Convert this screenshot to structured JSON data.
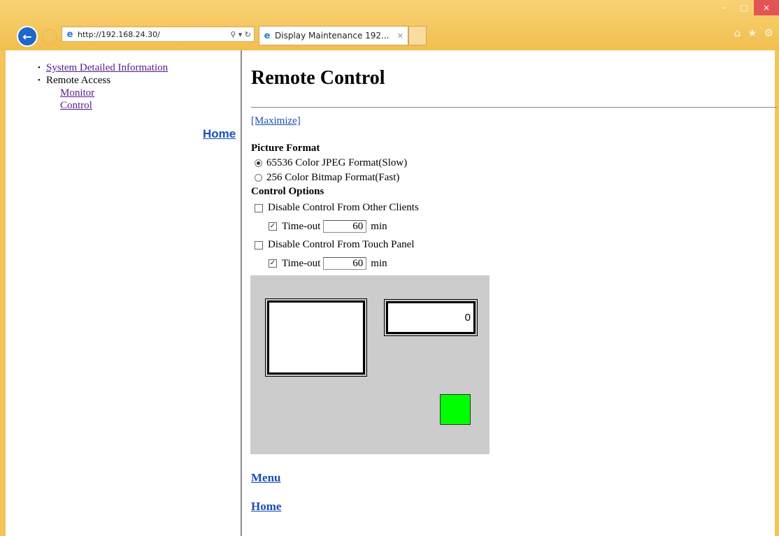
{
  "browser": {
    "url_host": "http://192.168.24.30/",
    "tab_title": "Display Maintenance 192...",
    "window_buttons": {
      "minimize": "–",
      "maximize": "□",
      "close": "×"
    },
    "icons": {
      "home": "home-icon",
      "favorites": "star-icon",
      "settings": "gear-icon"
    }
  },
  "sidebar": {
    "items": [
      {
        "label": "System Detailed Information",
        "link": true
      },
      {
        "label": "Remote Access",
        "link": false,
        "children": [
          "Monitor",
          "Control"
        ]
      }
    ],
    "home_label": "Home"
  },
  "main": {
    "title": "Remote Control",
    "maximize_label": "[Maximize]",
    "picture_format": {
      "label": "Picture Format",
      "options": [
        {
          "label": "65536 Color JPEG Format(Slow)",
          "selected": true
        },
        {
          "label": "256 Color Bitmap Format(Fast)",
          "selected": false
        }
      ]
    },
    "control_options": {
      "label": "Control Options",
      "other_clients": {
        "label": "Disable Control From Other Clients",
        "checked": false,
        "timeout_label": "Time-out",
        "timeout_checked": true,
        "timeout_value": "60",
        "unit": "min"
      },
      "touch_panel": {
        "label": "Disable Control From Touch Panel",
        "checked": false,
        "timeout_label": "Time-out",
        "timeout_checked": true,
        "timeout_value": "60",
        "unit": "min"
      }
    },
    "remote_screen": {
      "counter_value": "0",
      "background_color": "#cccccc",
      "button_color": "#00ff00"
    },
    "menu_label": "Menu",
    "home_label": "Home"
  }
}
